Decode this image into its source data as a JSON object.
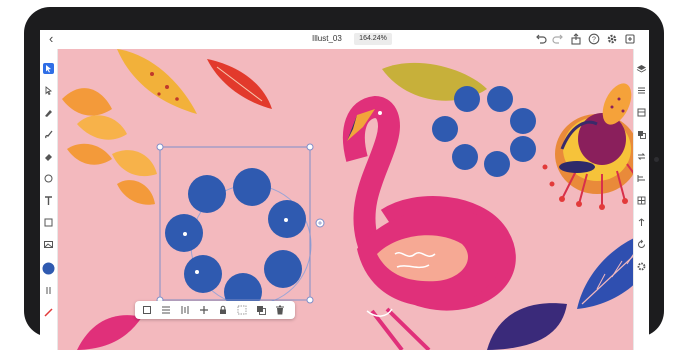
{
  "app": {
    "document_title": "Illust_03",
    "zoom_level": "164.24%"
  },
  "colors": {
    "canvas_background": "#f3b9be",
    "selection": "#7f8fc9",
    "accent_blue": "#2f5ab0",
    "flamingo_pink": "#e0307a",
    "active_tool": "#2f6ee6"
  },
  "toolbar_left": [
    "select-tool",
    "direct-select-tool",
    "pen-tool",
    "brush-tool",
    "eraser-tool",
    "shape-tool",
    "text-tool",
    "image-tool",
    "picture-tool",
    "color-swatch",
    "stroke-tool",
    "line-color"
  ],
  "toolbar_right": [
    "layers-icon",
    "align-icon",
    "properties-icon",
    "arrange-icon",
    "repeat-icon",
    "distribute-icon",
    "grid-icon",
    "path-icon",
    "rotate-icon",
    "settings-icon"
  ],
  "context_bar": [
    "transform-icon",
    "align-icon",
    "distribute-icon",
    "plus-icon",
    "lock-icon",
    "group-icon",
    "duplicate-icon",
    "delete-icon"
  ]
}
